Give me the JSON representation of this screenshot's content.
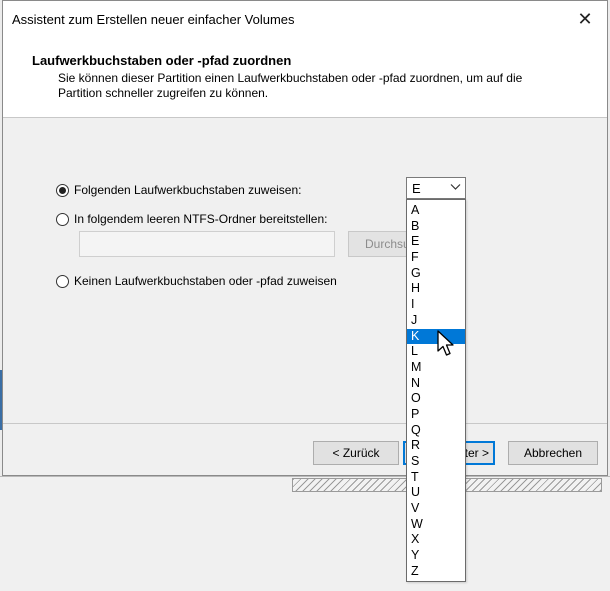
{
  "window": {
    "title": "Assistent zum Erstellen neuer einfacher Volumes",
    "close_glyph": "✕"
  },
  "header": {
    "title": "Laufwerkbuchstaben oder -pfad zuordnen",
    "description": "Sie können dieser Partition einen Laufwerkbuchstaben oder -pfad zuordnen, um auf die Partition schneller zugreifen zu können."
  },
  "options": {
    "assign_letter": {
      "label": "Folgenden Laufwerkbuchstaben zuweisen:",
      "checked": true
    },
    "mount_folder": {
      "label": "In folgendem leeren NTFS-Ordner bereitstellen:",
      "checked": false
    },
    "no_letter": {
      "label": "Keinen Laufwerkbuchstaben oder -pfad zuweisen",
      "checked": false
    }
  },
  "folder_path": {
    "value": ""
  },
  "browse_button": {
    "label": "Durchsuchen..."
  },
  "drive_letter": {
    "selected": "E",
    "highlighted": "K",
    "options": [
      "A",
      "B",
      "E",
      "F",
      "G",
      "H",
      "I",
      "J",
      "K",
      "L",
      "M",
      "N",
      "O",
      "P",
      "Q",
      "R",
      "S",
      "T",
      "U",
      "V",
      "W",
      "X",
      "Y",
      "Z"
    ]
  },
  "buttons": {
    "back": "< Zurück",
    "next": "Weiter >",
    "cancel": "Abbrechen"
  },
  "colors": {
    "accent": "#0078d7"
  }
}
